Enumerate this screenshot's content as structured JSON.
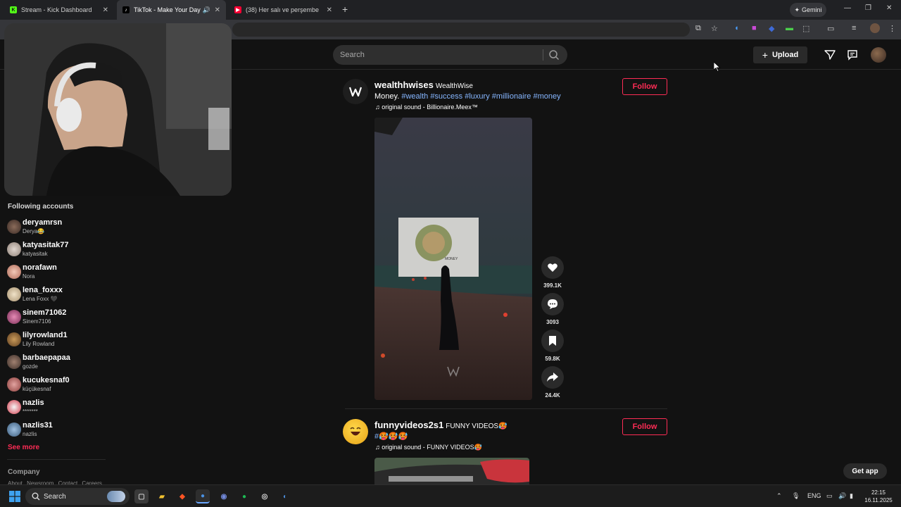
{
  "browser": {
    "tabs": [
      {
        "title": "Stream - Kick Dashboard",
        "favicon": "kick-icon",
        "color": "#53fc18"
      },
      {
        "title": "TikTok - Make Your Day",
        "favicon": "tiktok-icon",
        "active": true
      },
      {
        "title": "(38) Her salı ve perşembe",
        "favicon": "youtube-icon",
        "color": "#ff0033"
      }
    ],
    "gemini_label": "Gemini"
  },
  "tiktok": {
    "search": {
      "placeholder": "Search"
    },
    "upload_label": "Upload",
    "accent": "#fe2c55"
  },
  "sidebar": {
    "title": "Following accounts",
    "accounts": [
      {
        "username": "deryamrsn",
        "name": "Derya😂"
      },
      {
        "username": "katyasitak77",
        "name": "katyasitak"
      },
      {
        "username": "norafawn",
        "name": "Nora"
      },
      {
        "username": "lena_foxxx",
        "name": "Lena Foxx 🖤"
      },
      {
        "username": "sinem71062",
        "name": "Sinem7106"
      },
      {
        "username": "lilyrowland1",
        "name": "Lily Rowland"
      },
      {
        "username": "barbaepapaa",
        "name": "gozde"
      },
      {
        "username": "kucukesnaf0",
        "name": "küçükesnaf"
      },
      {
        "username": "nazlis",
        "name": "*******"
      },
      {
        "username": "nazlis31",
        "name": "nazlis"
      }
    ],
    "see_more": "See more",
    "company": "Company",
    "footer_links": [
      "About",
      "Newsroom",
      "Contact",
      "Careers"
    ]
  },
  "feed": {
    "posts": [
      {
        "username": "wealthhwises",
        "nickname": "WealthWise",
        "desc_text": "Money.",
        "hashtags": [
          "#wealth",
          "#success",
          "#luxury",
          "#millionaire",
          "#money"
        ],
        "sound": "original sound - Billionaire.Meex™",
        "follow_label": "Follow",
        "video_overlay_text": "MONEY",
        "likes": "399.1K",
        "comments": "3093",
        "saves": "59.8K",
        "shares": "24.4K"
      },
      {
        "username": "funnyvideos2s1",
        "nickname": "FUNNY VIDEOS🥵",
        "desc_text": "#🥵🥵🥵",
        "sound": "original sound - FUNNY VIDEOS🥵",
        "follow_label": "Follow"
      }
    ]
  },
  "get_app": "Get app",
  "taskbar": {
    "search_label": "Search",
    "language": "ENG",
    "time": "22:15",
    "date": "16.11.2025"
  }
}
